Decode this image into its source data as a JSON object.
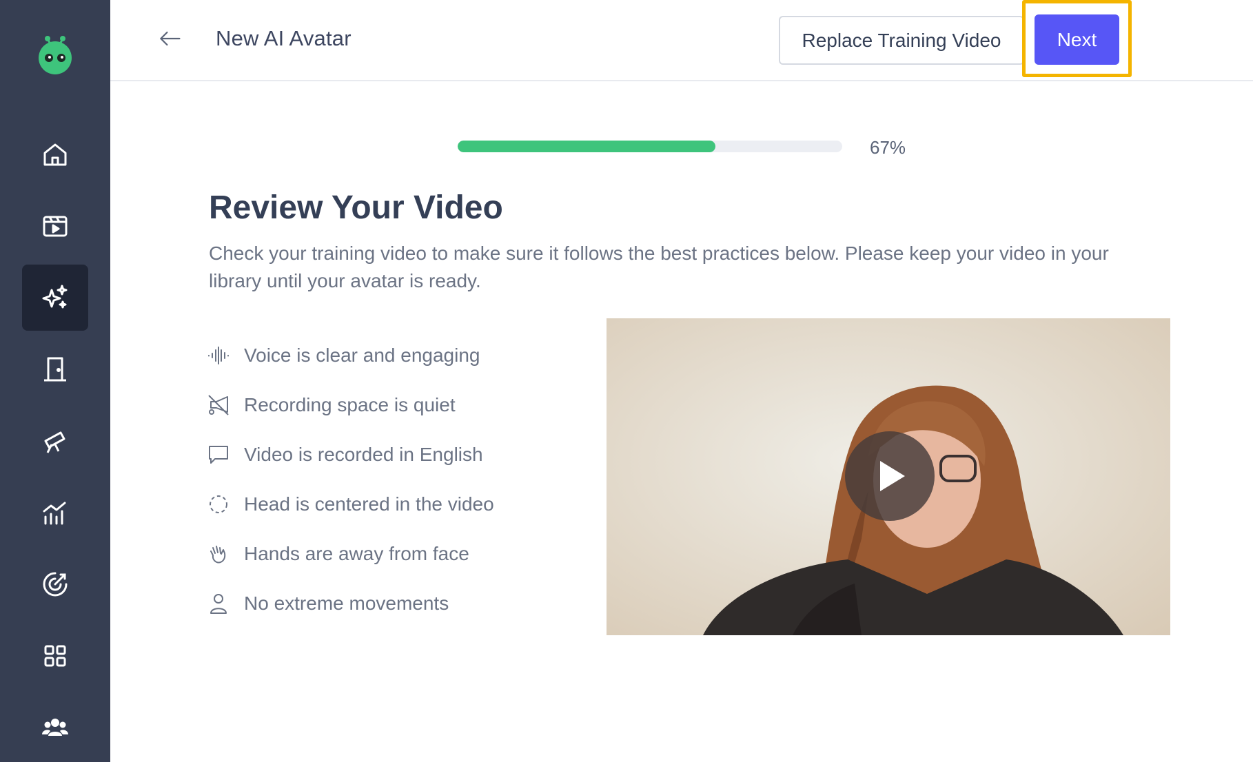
{
  "header": {
    "title": "New AI Avatar",
    "replace_label": "Replace Training Video",
    "next_label": "Next"
  },
  "progress": {
    "percent": 67,
    "label": "67%"
  },
  "review": {
    "heading": "Review Your Video",
    "description": "Check your training video to make sure it follows the best practices below. Please keep your video in your library until your avatar is ready."
  },
  "checklist": [
    {
      "icon": "waveform-icon",
      "label": "Voice is clear and engaging"
    },
    {
      "icon": "megaphone-off-icon",
      "label": "Recording space is quiet"
    },
    {
      "icon": "chat-bubble-icon",
      "label": "Video is recorded in English"
    },
    {
      "icon": "dashed-circle-icon",
      "label": "Head is centered in the video"
    },
    {
      "icon": "hand-wave-icon",
      "label": "Hands are away from face"
    },
    {
      "icon": "person-icon",
      "label": "No extreme movements"
    }
  ],
  "sidebar": {
    "items": [
      {
        "icon": "home-icon",
        "active": false
      },
      {
        "icon": "video-clapper-icon",
        "active": false
      },
      {
        "icon": "sparkles-icon",
        "active": true
      },
      {
        "icon": "door-icon",
        "active": false
      },
      {
        "icon": "telescope-icon",
        "active": false
      },
      {
        "icon": "analytics-icon",
        "active": false
      },
      {
        "icon": "target-icon",
        "active": false
      },
      {
        "icon": "apps-grid-icon",
        "active": false
      },
      {
        "icon": "team-icon",
        "active": false
      }
    ]
  },
  "colors": {
    "sidebar_bg": "#363e52",
    "accent": "#5756f6",
    "progress": "#3ec47c",
    "highlight": "#f4b400"
  }
}
